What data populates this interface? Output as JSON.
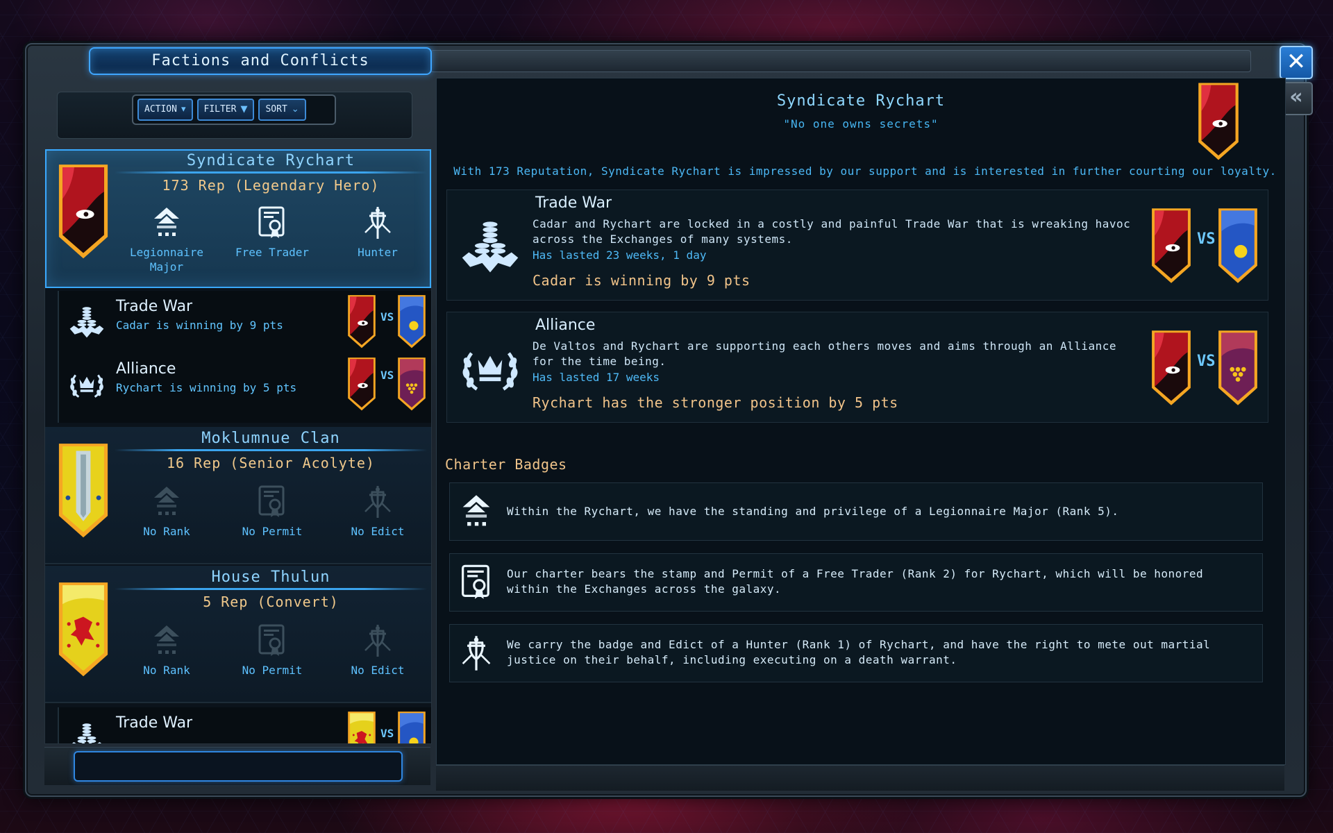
{
  "window": {
    "title": "Factions and Conflicts",
    "close_icon": "close-icon",
    "collapse_icon": "double-chevron-left-icon"
  },
  "toolbar": {
    "action_label": "ACTION",
    "filter_label": "FILTER",
    "sort_label": "SORT"
  },
  "colors": {
    "accent": "#3aa9ff",
    "reputation": "#f1c98b",
    "badge_text": "#5ec2ff",
    "red_banner": "#b0141e",
    "blue_banner": "#2456c4",
    "yellow_banner": "#e8d21c",
    "magenta_banner": "#8b2a6a"
  },
  "factions": [
    {
      "name": "Syndicate Rychart",
      "rep": "173 Rep (Legendary Hero)",
      "badges": [
        {
          "label": "Legionnaire Major",
          "icon": "rank-icon"
        },
        {
          "label": "Free Trader",
          "icon": "permit-icon"
        },
        {
          "label": "Hunter",
          "icon": "edict-icon"
        }
      ],
      "conflicts": [
        {
          "title": "Trade War",
          "status": "Cadar is winning by 9 pts",
          "vs": "VS"
        },
        {
          "title": "Alliance",
          "status": "Rychart is winning by 5 pts",
          "vs": "VS"
        }
      ]
    },
    {
      "name": "Moklumnue Clan",
      "rep": "16 Rep (Senior Acolyte)",
      "badges": [
        {
          "label": "No Rank",
          "icon": "rank-icon"
        },
        {
          "label": "No Permit",
          "icon": "permit-icon"
        },
        {
          "label": "No Edict",
          "icon": "edict-icon"
        }
      ]
    },
    {
      "name": "House Thulun",
      "rep": "5 Rep (Convert)",
      "badges": [
        {
          "label": "No Rank",
          "icon": "rank-icon"
        },
        {
          "label": "No Permit",
          "icon": "permit-icon"
        },
        {
          "label": "No Edict",
          "icon": "edict-icon"
        }
      ],
      "conflicts": [
        {
          "title": "Trade War",
          "vs": "VS"
        }
      ]
    }
  ],
  "detail": {
    "name": "Syndicate Rychart",
    "motto": "\"No one owns secrets\"",
    "summary": "With 173 Reputation, Syndicate Rychart is impressed by our support and is interested in further courting our loyalty.",
    "conflicts": [
      {
        "title": "Trade War",
        "description": "Cadar and Rychart are locked in a costly and painful Trade War that is wreaking havoc across the Exchanges of many systems.",
        "duration": "Has lasted 23 weeks, 1 day",
        "winning": "Cadar is winning by 9 pts",
        "vs": "VS"
      },
      {
        "title": "Alliance",
        "description": "De Valtos and Rychart are supporting each others moves and aims through an Alliance for the time being.",
        "duration": "Has lasted 17 weeks",
        "winning": "Rychart has the stronger position by 5 pts",
        "vs": "VS"
      }
    ],
    "charter_heading": "Charter Badges",
    "charters": [
      {
        "icon": "rank-icon",
        "text": "Within the Rychart, we have the standing and privilege of a Legionnaire Major (Rank 5)."
      },
      {
        "icon": "permit-icon",
        "text": "Our charter bears the stamp and Permit of a Free Trader (Rank 2) for Rychart, which will be honored within the Exchanges across the galaxy."
      },
      {
        "icon": "edict-icon",
        "text": "We carry the badge and Edict of a Hunter (Rank 1) of Rychart, and have the right to mete out martial justice on their behalf, including executing on a death warrant."
      }
    ]
  }
}
